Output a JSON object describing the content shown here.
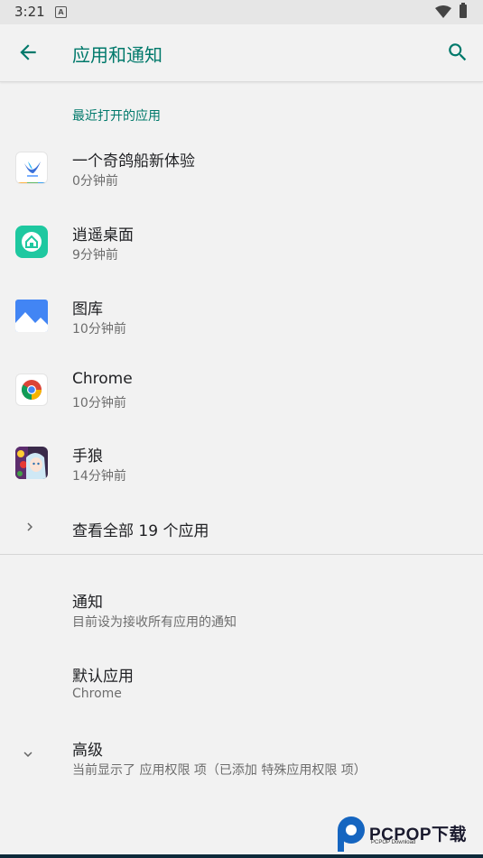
{
  "status_bar": {
    "time": "3:21",
    "notification_icon": "A"
  },
  "app_bar": {
    "title": "应用和通知"
  },
  "recent": {
    "header": "最近打开的应用",
    "apps": [
      {
        "name": "一个奇鸽船新体验",
        "time": "0分钟前"
      },
      {
        "name": "逍遥桌面",
        "time": "9分钟前"
      },
      {
        "name": "图库",
        "time": "10分钟前"
      },
      {
        "name": "Chrome",
        "time": "10分钟前"
      },
      {
        "name": "手狼",
        "time": "14分钟前"
      }
    ],
    "see_all": "查看全部 19 个应用"
  },
  "settings": {
    "notifications": {
      "title": "通知",
      "summary": "目前设为接收所有应用的通知"
    },
    "default_apps": {
      "title": "默认应用",
      "summary": "Chrome"
    },
    "advanced": {
      "title": "高级",
      "summary": "当前显示了 应用权限 项（已添加 特殊应用权限 项）"
    }
  },
  "watermark": {
    "brand": "PCPOP下载",
    "sub": "PCPOP Download"
  },
  "colors": {
    "accent": "#00796b",
    "background": "#f2f2f2"
  }
}
